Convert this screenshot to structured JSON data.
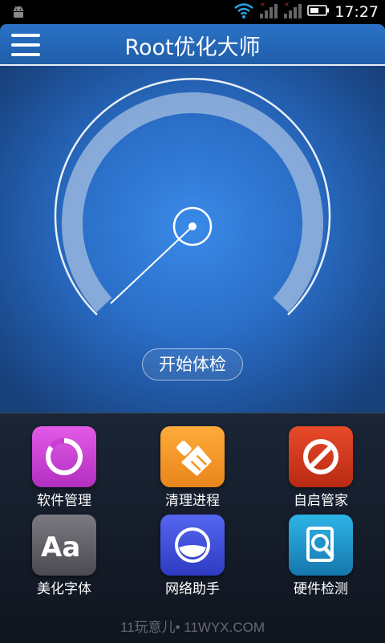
{
  "status_bar": {
    "time": "17:27"
  },
  "header": {
    "title": "Root优化大师"
  },
  "gauge": {
    "check_button_label": "开始体检"
  },
  "tools": [
    {
      "label": "软件管理",
      "color": "#c93fd3"
    },
    {
      "label": "清理进程",
      "color": "#f0951f"
    },
    {
      "label": "自启管家",
      "color": "#d23a1f"
    },
    {
      "label": "美化字体",
      "color": "#5d5d62"
    },
    {
      "label": "网络助手",
      "color": "#3c4fd9"
    },
    {
      "label": "硬件检测",
      "color": "#1f93c9"
    }
  ],
  "watermark": "11玩意儿• 11WYX.COM"
}
